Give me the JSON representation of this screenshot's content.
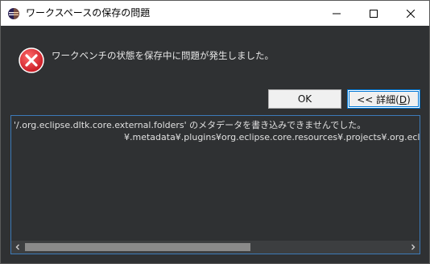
{
  "window": {
    "title": "ワークスペースの保存の問題",
    "icon": "eclipse-icon"
  },
  "message": {
    "icon": "error-icon",
    "text": "ワークベンチの状態を保存中に問題が発生しました。"
  },
  "buttons": {
    "ok_label": "OK",
    "details_prefix": "<< 詳細(",
    "details_mnemonic": "D",
    "details_suffix": ")"
  },
  "details": {
    "lines": [
      "'/.org.eclipse.dltk.core.external.folders' のメタデータを書き込みできませんでした。",
      "¥.metadata¥.plugins¥org.eclipse.core.resources¥.projects¥.org.eclipse"
    ]
  },
  "colors": {
    "error_red": "#d9232e",
    "focus_blue": "#0078d7",
    "eclipse_purple": "#2c2255"
  }
}
